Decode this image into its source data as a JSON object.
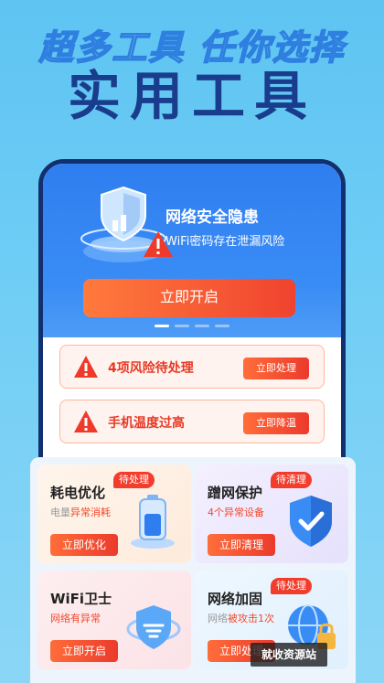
{
  "hero": {
    "subtitle": "超多工具 任你选择",
    "title": "实用工具"
  },
  "security": {
    "title": "网络安全隐患",
    "description": "WiFi密码存在泄漏风险",
    "start_label": "立即开启"
  },
  "alerts": [
    {
      "text": "4项风险待处理",
      "button": "立即处理"
    },
    {
      "text": "手机温度过高",
      "button": "立即降温"
    }
  ],
  "tools": [
    {
      "name": "耗电优化",
      "tag": "待处理",
      "desc_prefix": "电量",
      "desc_highlight": "异常消耗",
      "button": "立即优化",
      "icon": "battery-icon"
    },
    {
      "name": "蹭网保护",
      "tag": "待清理",
      "desc_prefix": "",
      "desc_highlight": "4个异常设备",
      "button": "立即清理",
      "icon": "shield-check-icon"
    },
    {
      "name": "WiFi卫士",
      "tag": "",
      "desc_prefix": "",
      "desc_highlight": "网络有异常",
      "button": "立即开启",
      "icon": "wifi-shield-icon"
    },
    {
      "name": "网络加固",
      "tag": "待处理",
      "desc_prefix": "网络",
      "desc_highlight": "被攻击1次",
      "button": "立即处理",
      "icon": "globe-lock-icon"
    }
  ],
  "watermark": "就收资源站",
  "colors": {
    "accent_red": "#f23c2c",
    "brand_blue": "#2f7ef0",
    "title_navy": "#1a3c8c"
  }
}
